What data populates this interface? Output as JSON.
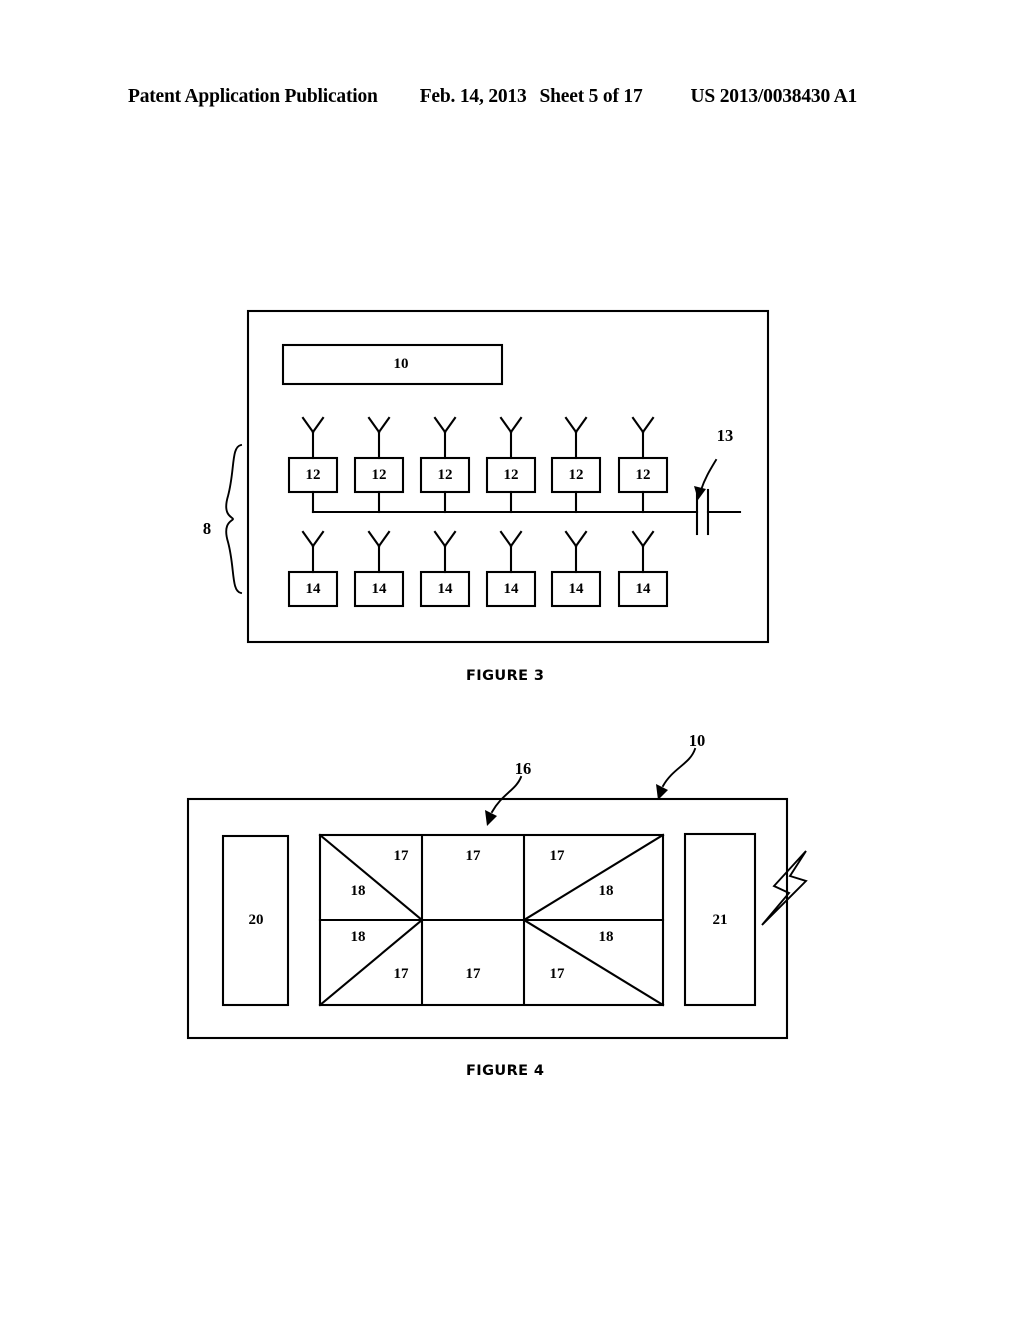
{
  "header": {
    "publication": "Patent Application Publication",
    "date": "Feb. 14, 2013",
    "sheet": "Sheet 5 of 17",
    "number": "US 2013/0038430 A1"
  },
  "figures": [
    {
      "id": "figure-3",
      "caption": "FIGURE 3",
      "enclosure_label": "",
      "group_brace_label": "8",
      "controller_box": "10",
      "termination_label": "13",
      "row_upper_boxes": [
        "12",
        "12",
        "12",
        "12",
        "12",
        "12"
      ],
      "row_lower_boxes": [
        "14",
        "14",
        "14",
        "14",
        "14",
        "14"
      ]
    },
    {
      "id": "figure-4",
      "caption": "FIGURE 4",
      "enclosure_label": "10",
      "grid_label": "16",
      "left_box": "20",
      "right_box": "21",
      "grid_cells": [
        {
          "row": "top",
          "col": "left",
          "outer": "17",
          "inner": "18"
        },
        {
          "row": "top",
          "col": "middle",
          "outer": "17",
          "inner": ""
        },
        {
          "row": "top",
          "col": "right",
          "outer": "17",
          "inner": "18"
        },
        {
          "row": "bottom",
          "col": "left",
          "outer": "17",
          "inner": "18"
        },
        {
          "row": "bottom",
          "col": "middle",
          "outer": "17",
          "inner": ""
        },
        {
          "row": "bottom",
          "col": "right",
          "outer": "17",
          "inner": "18"
        }
      ],
      "rf_symbol": "lightning-bolt"
    }
  ],
  "colors": {
    "ink": "#000000",
    "paper": "#ffffff"
  }
}
